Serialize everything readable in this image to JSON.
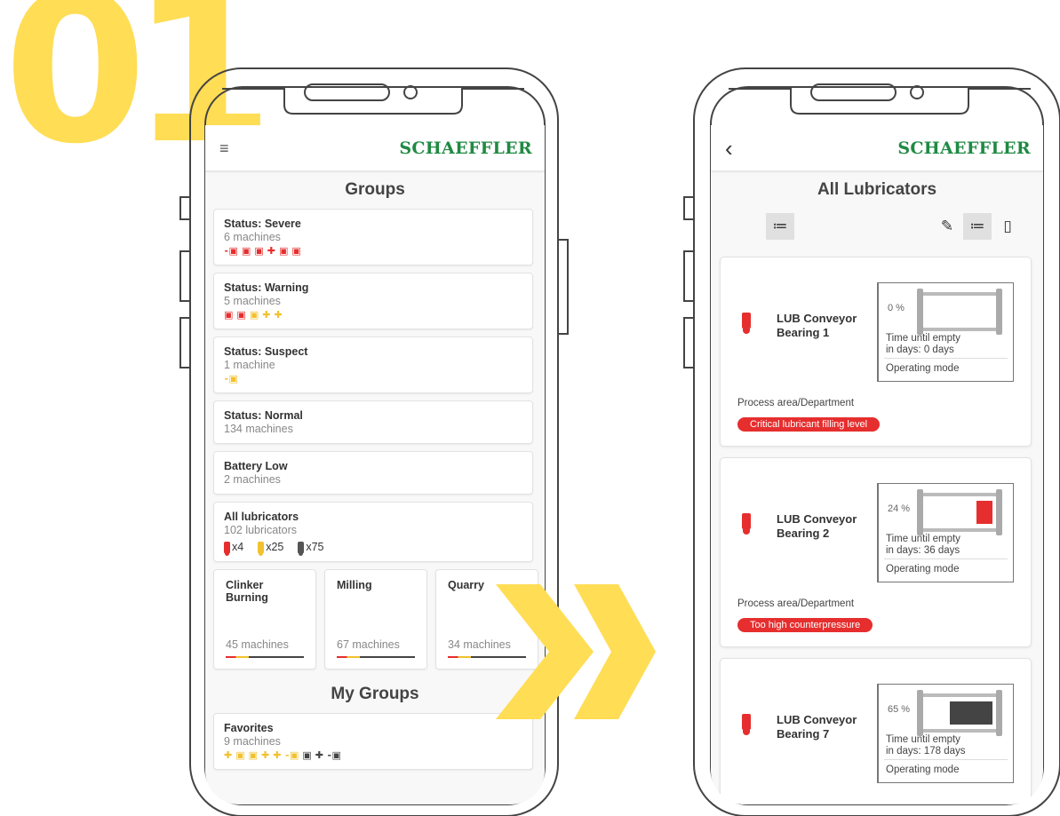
{
  "step_number": "01",
  "colors": {
    "brand": "#1f8a43",
    "severe": "#e62e2e",
    "warning": "#f2c12e",
    "accent_yellow": "#ffdd55"
  },
  "left_screen": {
    "brand": "SCHAEFFLER",
    "menu_icon": "hamburger-icon",
    "title": "Groups",
    "groups": [
      {
        "title": "Status: Severe",
        "subtitle": "6 machines",
        "icon_color": "red",
        "icons": [
          "pump-icon",
          "motor-icon",
          "motor-icon",
          "fan-icon",
          "motor-icon",
          "motor-icon"
        ]
      },
      {
        "title": "Status: Warning",
        "subtitle": "5 machines",
        "icon_color": "mixed",
        "icons": [
          "motor-icon",
          "motor-icon",
          "motor-icon",
          "fan-icon",
          "fan-icon"
        ]
      },
      {
        "title": "Status: Suspect",
        "subtitle": "1 machine",
        "icon_color": "yellow",
        "icons": [
          "pump-icon"
        ]
      },
      {
        "title": "Status: Normal",
        "subtitle": "134 machines",
        "icons": []
      },
      {
        "title": "Battery Low",
        "subtitle": "2 machines",
        "icons": []
      }
    ],
    "all_lubricators": {
      "title": "All lubricators",
      "subtitle": "102 lubricators",
      "counts": [
        {
          "color": "#e62e2e",
          "label": "x4"
        },
        {
          "color": "#f2c12e",
          "label": "x25"
        },
        {
          "color": "#555555",
          "label": "x75"
        }
      ]
    },
    "tiles": [
      {
        "title": "Clinker Burning",
        "count": "45 machines"
      },
      {
        "title": "Milling",
        "count": "67 machines"
      },
      {
        "title": "Quarry",
        "count": "34 machines"
      }
    ],
    "my_groups_title": "My Groups",
    "favorites": {
      "title": "Favorites",
      "subtitle": "9 machines"
    }
  },
  "right_screen": {
    "brand": "SCHAEFFLER",
    "back_icon": "chevron-left-icon",
    "title": "All Lubricators",
    "lubricators": [
      {
        "name": "LUB Conveyor Bearing 1",
        "icon_color": "#e62e2e",
        "level_pct": "0 %",
        "level": 0.0,
        "fill_color": "#e62e2e",
        "time_label": "Time until empty",
        "time_value": "in days: 0 days",
        "mode": "Operating mode",
        "dept": "Process area/Department",
        "alert": "Critical lubricant filling level"
      },
      {
        "name": "LUB Conveyor Bearing 2",
        "icon_color": "#e62e2e",
        "level_pct": "24 %",
        "level": 0.24,
        "fill_color": "#e62e2e",
        "time_label": "Time until empty",
        "time_value": "in days: 36 days",
        "mode": "Operating mode",
        "dept": "Process area/Department",
        "alert": "Too high counterpressure"
      },
      {
        "name": "LUB Conveyor Bearing 7",
        "icon_color": "#e62e2e",
        "level_pct": "65 %",
        "level": 0.65,
        "fill_color": "#444444",
        "time_label": "Time until empty",
        "time_value": "in days: 178 days",
        "mode": "Operating mode",
        "dept": "",
        "alert": ""
      }
    ]
  }
}
